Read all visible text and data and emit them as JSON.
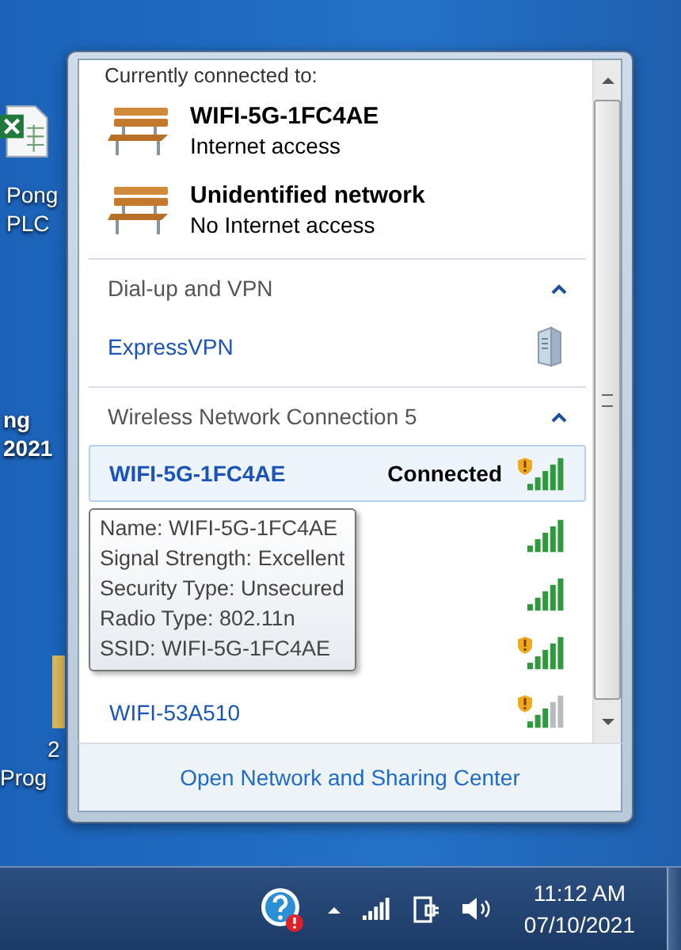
{
  "desktop": {
    "icons": [
      {
        "kind": "spreadsheet",
        "lines": [
          "Pong",
          "PLC"
        ]
      },
      {
        "kind": "none",
        "lines": [
          "ng",
          "2021"
        ]
      },
      {
        "kind": "folder",
        "lines": [
          "2",
          "Prog"
        ]
      }
    ]
  },
  "popup": {
    "connected_heading": "Currently connected to:",
    "connections": [
      {
        "name": "WIFI-5G-1FC4AE",
        "status": "Internet access"
      },
      {
        "name": "Unidentified network",
        "status": "No Internet access"
      }
    ],
    "sections": [
      {
        "title": "Dial-up and VPN",
        "expanded": true,
        "kind": "vpn",
        "items": [
          {
            "name": "ExpressVPN"
          }
        ]
      },
      {
        "title": "Wireless Network Connection 5",
        "expanded": true,
        "kind": "wifi",
        "items": [
          {
            "name": "WIFI-5G-1FC4AE",
            "status": "Connected",
            "selected": true,
            "unsecured": true,
            "weak_signal": false
          },
          {
            "selected": false,
            "unsecured": false,
            "weak_signal": false
          },
          {
            "selected": false,
            "unsecured": false,
            "weak_signal": false
          },
          {
            "selected": false,
            "unsecured": true,
            "weak_signal": false
          },
          {
            "name": "WIFI-53A510",
            "selected": false,
            "unsecured": true,
            "weak_signal": true
          }
        ]
      }
    ],
    "tooltip": {
      "lines": [
        "Name: WIFI-5G-1FC4AE",
        "Signal Strength: Excellent",
        "Security Type: Unsecured",
        "Radio Type: 802.11n",
        "SSID: WIFI-5G-1FC4AE"
      ]
    },
    "footer_link": "Open Network and Sharing Center"
  },
  "taskbar": {
    "clock": {
      "time": "11:12 AM",
      "date": "07/10/2021"
    }
  }
}
